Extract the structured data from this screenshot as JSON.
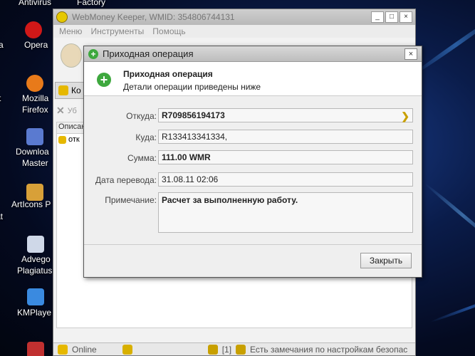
{
  "desktop": {
    "icons": [
      {
        "label": "Antivirus",
        "icon": "antivirus-icon"
      },
      {
        "label": "Factory",
        "icon": "factory-icon"
      },
      {
        "label": "a",
        "icon": "app-icon"
      },
      {
        "label": "Opera",
        "icon": "opera-icon"
      },
      {
        "label": "t",
        "icon": "app-icon"
      },
      {
        "label": "Mozilla",
        "icon": "firefox-icon"
      },
      {
        "label": "Firefox",
        "icon": "firefox-icon"
      },
      {
        "label": "Downloa",
        "icon": "download-master-icon"
      },
      {
        "label": "Master",
        "icon": "download-master-icon"
      },
      {
        "label": "ArtIcons P",
        "icon": "articons-icon"
      },
      {
        "label": "at",
        "icon": "app-icon"
      },
      {
        "label": "Advego",
        "icon": "advego-icon"
      },
      {
        "label": "Plagiatus",
        "icon": "advego-icon"
      },
      {
        "label": "KMPlaye",
        "icon": "kmplayer-icon"
      }
    ]
  },
  "main_window": {
    "title": "WebMoney Keeper, WMID: 354806744131",
    "menu": [
      "Меню",
      "Инструменты",
      "Помощь"
    ],
    "tab_label": "Ко",
    "delete_label": "Уб",
    "column_header": "Описан",
    "row_text": "отк",
    "status": {
      "online": "Online",
      "count": "[1]",
      "notice": "Есть замечания по настройкам безопас"
    }
  },
  "dialog": {
    "title": "Приходная операция",
    "header_title": "Приходная операция",
    "header_subtitle": "Детали операции приведены ниже",
    "fields": {
      "from_label": "Откуда:",
      "from_value": "R709856194173",
      "to_label": "Куда:",
      "to_value": "R133413341334,",
      "amount_label": "Сумма:",
      "amount_value": "111.00 WMR",
      "date_label": "Дата перевода:",
      "date_value": "31.08.11 02:06",
      "note_label": "Примечание:",
      "note_value": "Расчет за выполненную работу."
    },
    "close_label": "Закрыть"
  },
  "colors": {
    "accent_green": "#3ea83e",
    "keeper_gold": "#e6c800",
    "desktop_blue": "#0a1c4a"
  }
}
